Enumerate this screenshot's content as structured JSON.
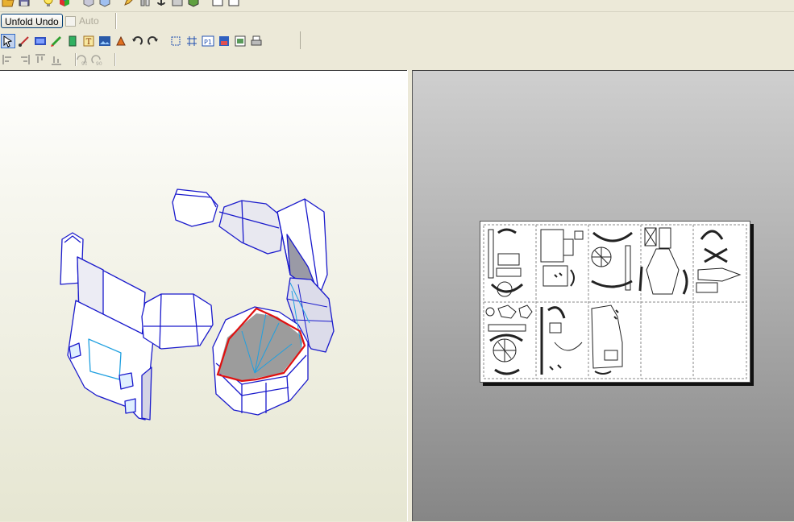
{
  "toolbar": {
    "unfold_undo_label": "Unfold Undo",
    "auto_label": "Auto",
    "auto_checked": false,
    "row1_icons": [
      "open-icon",
      "save-icon",
      "lightbulb-icon",
      "color-cube-icon",
      "cube-icon",
      "cube-light-icon",
      "pencil-icon",
      "slice-icon",
      "anchor-icon",
      "parts-icon",
      "scene-icon",
      "window-icon",
      "window2-icon"
    ],
    "row2_icons": [
      "select-icon",
      "edge-select-icon",
      "film-icon",
      "paint-icon",
      "face-icon",
      "text-icon",
      "image-icon",
      "move-icon",
      "undo-arrow-icon",
      "redo-arrow-icon",
      "fit-page-icon",
      "grid-icon",
      "page-number-icon",
      "layout-icon",
      "print-preview-icon",
      "print-icon"
    ],
    "row3_icons": [
      "align-left-icon",
      "align-right-icon",
      "align-top-icon",
      "align-bottom-icon",
      "rotate-left-90-icon",
      "rotate-right-90-icon"
    ]
  },
  "colors": {
    "chrome": "#ece9d8",
    "model_edge": "#1a1acc",
    "selected_edge": "#e01010",
    "fold_line": "#20a0e0"
  },
  "views": {
    "left": "3D model view",
    "right": "2D paper layout view"
  }
}
